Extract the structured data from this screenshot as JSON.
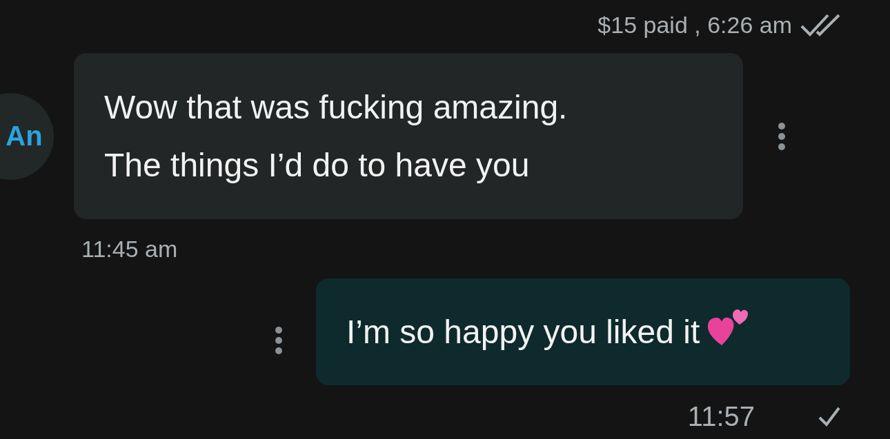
{
  "messages": [
    {
      "kind": "incoming",
      "meta": {
        "text": "$15 paid , 6:26 am",
        "read": true
      },
      "avatar": {
        "initials": "An"
      },
      "lines": [
        "Wow that was fucking amazing.",
        "The things I’d do to have you"
      ],
      "time": "11:45 am"
    },
    {
      "kind": "outgoing",
      "lines": [
        "I’m so happy you liked it"
      ],
      "emoji": true,
      "time": "11:57",
      "read": false
    }
  ]
}
